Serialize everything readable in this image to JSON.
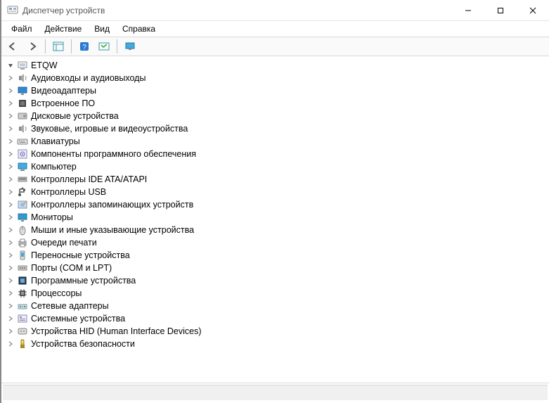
{
  "window": {
    "title": "Диспетчер устройств"
  },
  "menu": {
    "file": "Файл",
    "action": "Действие",
    "view": "Вид",
    "help": "Справка"
  },
  "tree": {
    "root": {
      "label": "ETQW",
      "expanded": true
    },
    "categories": [
      {
        "label": "Аудиовходы и аудиовыходы",
        "icon": "audio"
      },
      {
        "label": "Видеоадаптеры",
        "icon": "display"
      },
      {
        "label": "Встроенное ПО",
        "icon": "firmware"
      },
      {
        "label": "Дисковые устройства",
        "icon": "disk"
      },
      {
        "label": "Звуковые, игровые и видеоустройства",
        "icon": "audio"
      },
      {
        "label": "Клавиатуры",
        "icon": "keyboard"
      },
      {
        "label": "Компоненты программного обеспечения",
        "icon": "software"
      },
      {
        "label": "Компьютер",
        "icon": "computer"
      },
      {
        "label": "Контроллеры IDE ATA/ATAPI",
        "icon": "ide"
      },
      {
        "label": "Контроллеры USB",
        "icon": "usb"
      },
      {
        "label": "Контроллеры запоминающих устройств",
        "icon": "storage"
      },
      {
        "label": "Мониторы",
        "icon": "monitor"
      },
      {
        "label": "Мыши и иные указывающие устройства",
        "icon": "mouse"
      },
      {
        "label": "Очереди печати",
        "icon": "printer"
      },
      {
        "label": "Переносные устройства",
        "icon": "portable"
      },
      {
        "label": "Порты (COM и LPT)",
        "icon": "port"
      },
      {
        "label": "Программные устройства",
        "icon": "softdev"
      },
      {
        "label": "Процессоры",
        "icon": "cpu"
      },
      {
        "label": "Сетевые адаптеры",
        "icon": "network"
      },
      {
        "label": "Системные устройства",
        "icon": "system"
      },
      {
        "label": "Устройства HID (Human Interface Devices)",
        "icon": "hid"
      },
      {
        "label": "Устройства безопасности",
        "icon": "security"
      }
    ]
  }
}
